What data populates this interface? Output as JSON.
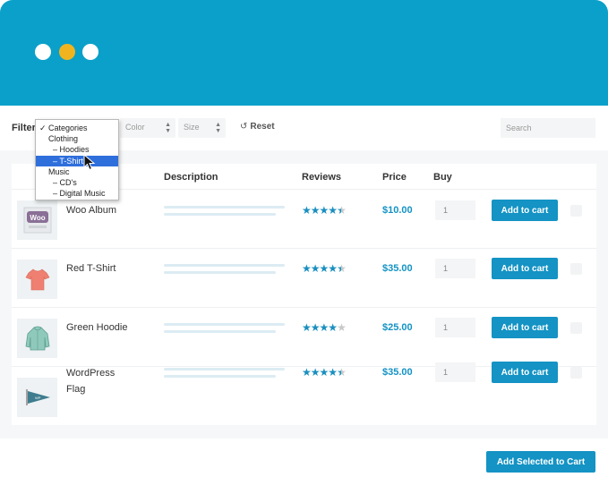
{
  "window": {
    "dots": [
      "close",
      "minimize",
      "maximize"
    ]
  },
  "filter": {
    "label": "Filter",
    "category_options": [
      {
        "label": "Categories",
        "checked": true
      },
      {
        "label": "Clothing"
      },
      {
        "label": "– Hoodies"
      },
      {
        "label": "– T-Shirt",
        "selected": true
      },
      {
        "label": "Music"
      },
      {
        "label": "– CD's"
      },
      {
        "label": "– Digital Music"
      }
    ],
    "check_glyph": "✓",
    "color_select": "Color",
    "size_select": "Size",
    "reset_icon": "↺",
    "reset_label": "Reset",
    "search_placeholder": "Search"
  },
  "table": {
    "headers": {
      "description": "Description",
      "reviews": "Reviews",
      "price": "Price",
      "buy": "Buy"
    },
    "rows": [
      {
        "name": "Woo Album",
        "rating": 4.5,
        "stars": "★★★★★",
        "price": "$10.00",
        "qty": "1",
        "button": "Add to cart",
        "icon": "woo-album-icon"
      },
      {
        "name": "Red T-Shirt",
        "rating": 4.5,
        "stars": "★★★★★",
        "price": "$35.00",
        "qty": "1",
        "button": "Add to cart",
        "icon": "tshirt-icon"
      },
      {
        "name": "Green Hoodie",
        "rating": 4,
        "stars": "★★★★★",
        "price": "$25.00",
        "qty": "1",
        "button": "Add to cart",
        "icon": "hoodie-icon"
      },
      {
        "name": "WordPress Flag",
        "name_lines": [
          "WordPress",
          "Flag"
        ],
        "rating": 4.5,
        "stars": "★★★★★",
        "price": "$35.00",
        "qty": "1",
        "button": "Add to cart",
        "icon": "pennant-flag-icon"
      }
    ]
  },
  "footer": {
    "add_selected_label": "Add Selected to Cart"
  },
  "colors": {
    "header_bg": "#0aa0c9",
    "accent": "#1493c4",
    "star": "#1a8fbf",
    "dot_yellow": "#f2b41e",
    "dropdown_selected": "#2f6fdc"
  }
}
